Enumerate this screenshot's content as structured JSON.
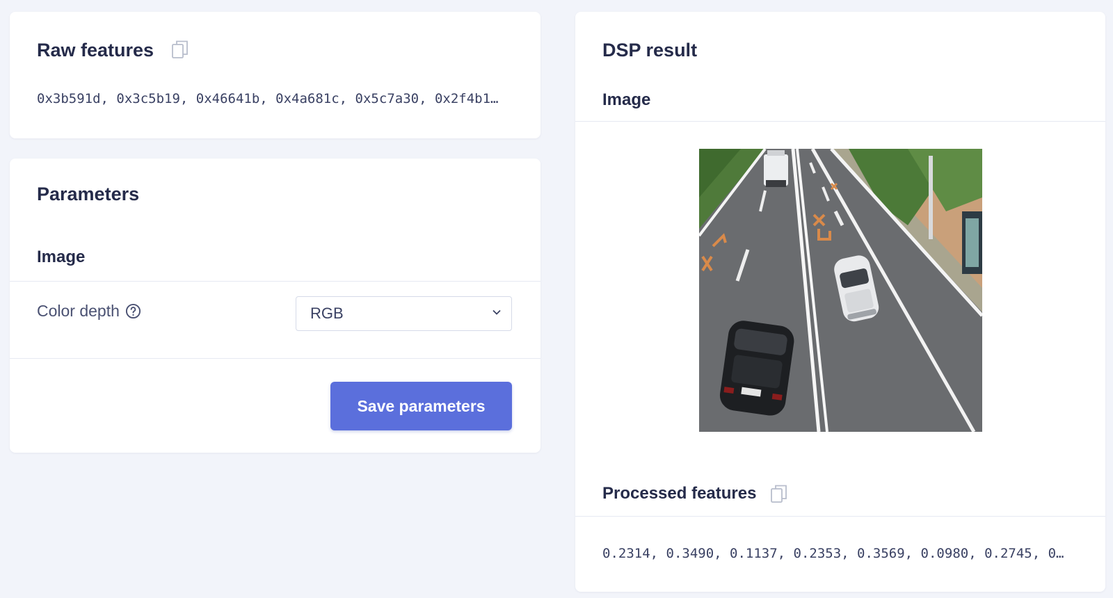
{
  "raw_features": {
    "title": "Raw features",
    "value": "0x3b591d, 0x3c5b19, 0x46641b, 0x4a681c, 0x5c7a30, 0x2f4b1…",
    "copy_icon": "copy-icon"
  },
  "parameters": {
    "title": "Parameters",
    "section": "Image",
    "color_depth_label": "Color depth",
    "help_icon": "help-circle-icon",
    "color_depth_value": "RGB",
    "save_label": "Save parameters"
  },
  "dsp_result": {
    "title": "DSP result",
    "image_heading": "Image",
    "processed_title": "Processed features",
    "processed_value": "0.2314, 0.3490, 0.1137, 0.2353, 0.3569, 0.0980, 0.2745, 0…",
    "copy_icon": "copy-icon"
  },
  "colors": {
    "page_background": "#f2f4fa",
    "card_background": "#ffffff",
    "accent": "#5b6fdc",
    "text_primary": "#252b4a"
  }
}
